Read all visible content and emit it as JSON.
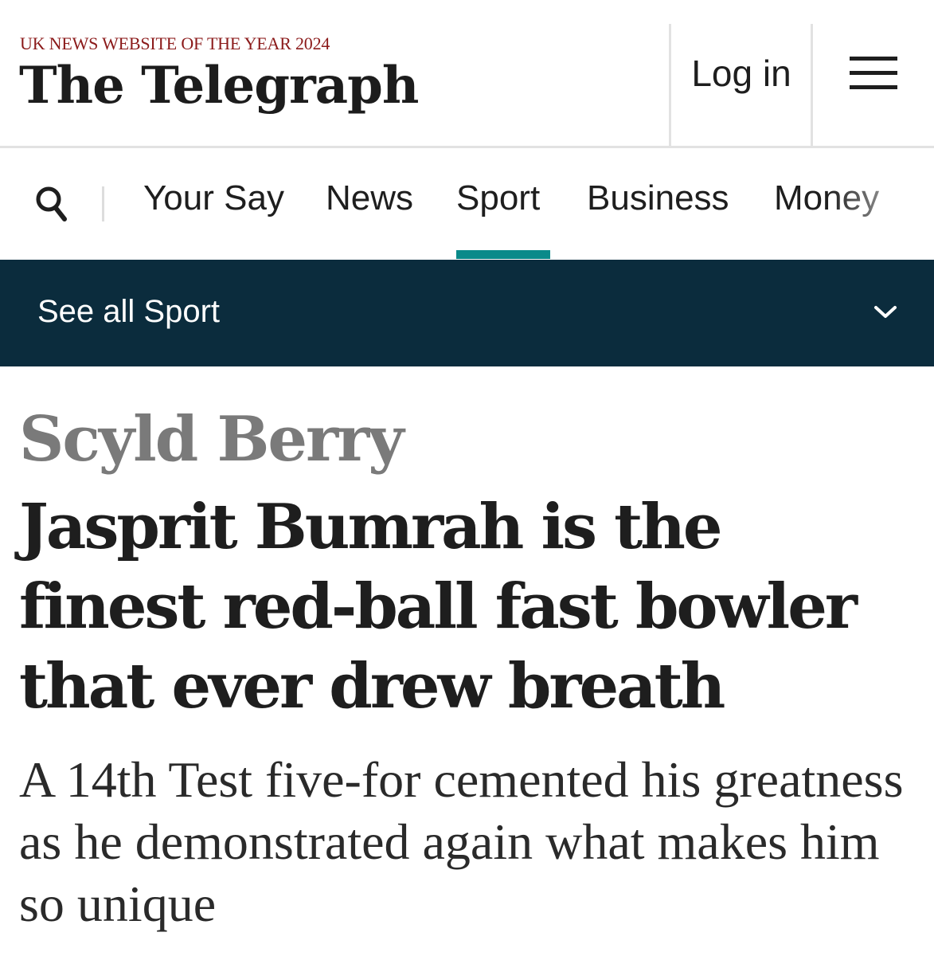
{
  "header": {
    "award": "UK NEWS WEBSITE OF THE YEAR 2024",
    "logo": "The Telegraph",
    "login_label": "Log in",
    "menu_icon": "hamburger-icon"
  },
  "nav": {
    "search_icon": "search-icon",
    "items": [
      {
        "label": "Your Say"
      },
      {
        "label": "News"
      },
      {
        "label": "Sport"
      },
      {
        "label": "Business"
      },
      {
        "label": "Money"
      }
    ],
    "active": "Sport",
    "accent_color": "#0a8a8a"
  },
  "subnav": {
    "label": "See all Sport",
    "chevron_icon": "chevron-down-icon",
    "background": "#0b2c3d"
  },
  "article": {
    "kicker": "Scyld Berry",
    "headline": "Jasprit Bumrah is the finest red-ball fast bowler that ever drew breath",
    "standfirst": "A 14th Test five-for cemented his greatness as he demonstrated again what makes him so unique"
  }
}
